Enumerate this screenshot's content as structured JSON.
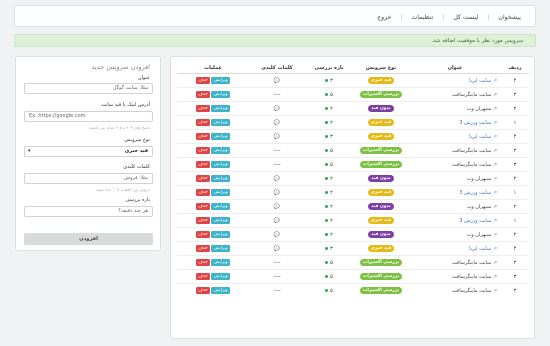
{
  "nav": {
    "items": [
      "پیشخوان",
      "لیست کل",
      "تنظیمات",
      "خروج"
    ]
  },
  "alert": {
    "message": "سرویس مورد نظر با موفقیت اضافه شد."
  },
  "table": {
    "headers": [
      "ردیف",
      "عنوان",
      "نوع سرویس",
      "بازه بررسی",
      "کلمات کلیدی",
      "عملیات"
    ],
    "edit_label": "ویرایش",
    "delete_label": "حذف",
    "rows": [
      {
        "id": "۴",
        "title": "سایت ایرنا",
        "ext_style": "link",
        "type": "فید خبری",
        "type_color": "#e6b917",
        "interval": "۳",
        "keywords": "comment"
      },
      {
        "id": "۳",
        "title": "سایت ماینگرسافت",
        "ext_style": "out",
        "type": "بررسی اکسپرات",
        "type_color": "#7cc142",
        "interval": "۵",
        "keywords": "----"
      },
      {
        "id": "۲",
        "title": "سپهران وب",
        "ext_style": "out",
        "type": "بدون فید",
        "type_color": "#7e3fa4",
        "interval": "۲",
        "keywords": "comment"
      },
      {
        "id": "۱",
        "title": "سایت ورزش 3",
        "ext_style": "link",
        "type": "فید خبری",
        "type_color": "#e6b917",
        "interval": "۲",
        "keywords": "comment"
      },
      {
        "id": "۴",
        "title": "سایت ایرنا",
        "ext_style": "link",
        "type": "فید خبری",
        "type_color": "#e6b917",
        "interval": "۳",
        "keywords": "comment"
      },
      {
        "id": "۳",
        "title": "سایت ماینگرسافت",
        "ext_style": "out",
        "type": "بررسی اکسپرات",
        "type_color": "#7cc142",
        "interval": "۵",
        "keywords": "----"
      },
      {
        "id": "۳",
        "title": "سایت ماینگرسافت",
        "ext_style": "out",
        "type": "بررسی اکسپرات",
        "type_color": "#7cc142",
        "interval": "۵",
        "keywords": "----"
      },
      {
        "id": "۲",
        "title": "سپهران وب",
        "ext_style": "out",
        "type": "بدون فید",
        "type_color": "#7e3fa4",
        "interval": "۲",
        "keywords": "comment"
      },
      {
        "id": "۱",
        "title": "سایت ورزش 3",
        "ext_style": "link",
        "type": "فید خبری",
        "type_color": "#e6b917",
        "interval": "۲",
        "keywords": "comment"
      },
      {
        "id": "۲",
        "title": "سپهران وب",
        "ext_style": "out",
        "type": "بدون فید",
        "type_color": "#7e3fa4",
        "interval": "۲",
        "keywords": "comment"
      },
      {
        "id": "۱",
        "title": "سایت ورزش 3",
        "ext_style": "link",
        "type": "فید خبری",
        "type_color": "#e6b917",
        "interval": "۲",
        "keywords": "comment"
      },
      {
        "id": "۲",
        "title": "سپهران وب",
        "ext_style": "out",
        "type": "بدون فید",
        "type_color": "#7e3fa4",
        "interval": "۲",
        "keywords": "comment"
      },
      {
        "id": "۴",
        "title": "سایت ایرنا",
        "ext_style": "link",
        "type": "فید خبری",
        "type_color": "#e6b917",
        "interval": "۳",
        "keywords": "comment"
      },
      {
        "id": "۳",
        "title": "سایت ماینگرسافت",
        "ext_style": "out",
        "type": "بررسی اکسپرات",
        "type_color": "#7cc142",
        "interval": "۵",
        "keywords": "----"
      },
      {
        "id": "۳",
        "title": "سایت ماینگرسافت",
        "ext_style": "out",
        "type": "بررسی اکسپرات",
        "type_color": "#7cc142",
        "interval": "۵",
        "keywords": "----"
      },
      {
        "id": "۳",
        "title": "سایت ماینگرسافت",
        "ext_style": "out",
        "type": "بررسی اکسپرات",
        "type_color": "#7cc142",
        "interval": "۵",
        "keywords": "----"
      }
    ]
  },
  "form": {
    "title": "افزودن سرویس جدید",
    "name_label": "عنوان",
    "name_placeholder": "مثلا: سایت گوگل",
    "url_label": "آدرس لینک یا فید سایت",
    "url_placeholder": "Ex: https://google.com",
    "url_hint": "پاسخ های ۴۰۳ و ۴۰۵ مجاز می باشند",
    "type_label": "نوع سرویس",
    "type_value": "فید خبری",
    "keywords_label": "کلمات کلیدی",
    "keywords_placeholder": "مثلا: فروش",
    "keywords_hint": "حروف بین کلمات با ',' جدا شوند",
    "interval_label": "بازه بررسی",
    "interval_placeholder": "هر چند دقیقه؟",
    "submit_label": "افزودن"
  }
}
